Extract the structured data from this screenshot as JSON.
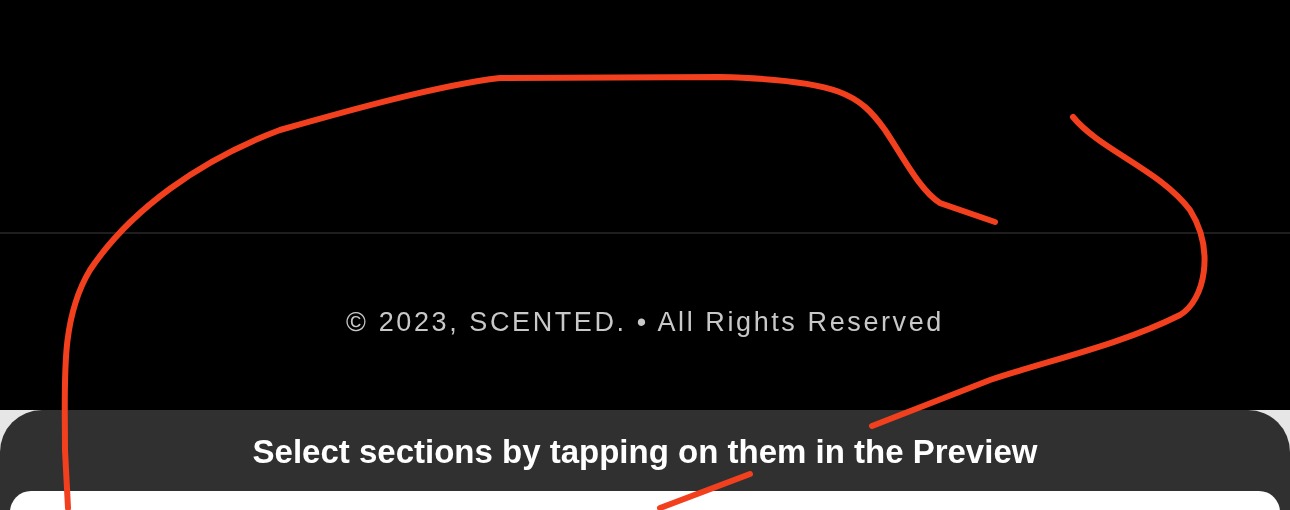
{
  "footer": {
    "copyright": "© 2023, SCENTED. • All Rights Reserved"
  },
  "sheet": {
    "instruction": "Select sections by tapping on them in the Preview"
  }
}
